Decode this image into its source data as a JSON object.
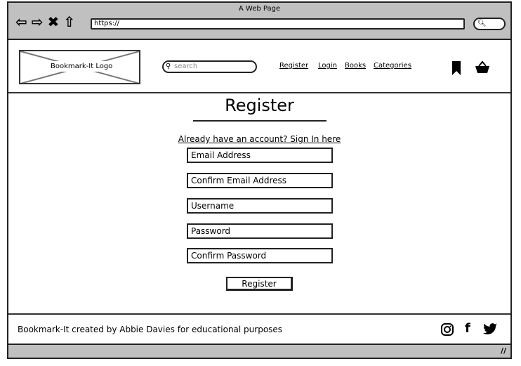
{
  "browser": {
    "title": "A Web Page",
    "url": "https://",
    "icons": [
      "back-arrow-icon",
      "forward-arrow-icon",
      "close-icon",
      "home-icon",
      "search-icon"
    ]
  },
  "header": {
    "logo_label": "Bookmark-It Logo",
    "search_placeholder": "search",
    "nav": [
      {
        "label": "Register"
      },
      {
        "label": "Login"
      },
      {
        "label": "Books"
      },
      {
        "label": "Categories"
      }
    ],
    "icons": [
      "bookmark-icon",
      "basket-icon"
    ]
  },
  "main": {
    "title": "Register",
    "signin_link": "Already have an account? Sign In here",
    "fields": [
      {
        "placeholder": "Email Address"
      },
      {
        "placeholder": "Confirm Email Address"
      },
      {
        "placeholder": "Username"
      },
      {
        "placeholder": "Password"
      },
      {
        "placeholder": "Confirm Password"
      }
    ],
    "submit_label": "Register"
  },
  "footer": {
    "text": "Bookmark-It created by Abbie Davies for educational purposes",
    "social": [
      "instagram-icon",
      "facebook-icon",
      "twitter-icon"
    ]
  }
}
